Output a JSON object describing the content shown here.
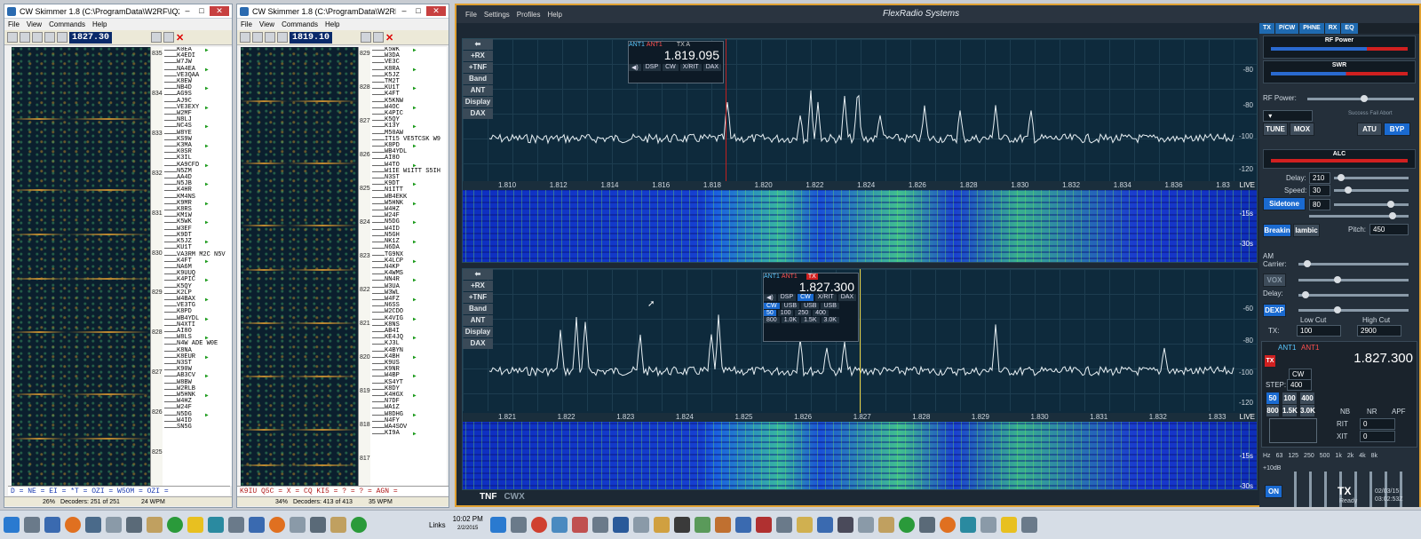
{
  "skimmer1": {
    "title": "CW Skimmer 1.8 (C:\\ProgramData\\W2RF\\IQ2.ini...",
    "freq": "1827.30",
    "menu": [
      "File",
      "View",
      "Commands",
      "Help"
    ],
    "scale": [
      "835",
      "834",
      "833",
      "832",
      "831",
      "830",
      "829",
      "828",
      "827",
      "826",
      "825"
    ],
    "calls": [
      "K0EA",
      "K4EDI",
      "W7JW",
      "NA4EA",
      "VE3QAA",
      "K8EW",
      "NB4D",
      "AG9S",
      "AJ9C",
      "VE3EXY",
      "W2MF",
      "N8LJ",
      "NC4S",
      "W8YE",
      "KS9W",
      "K3MA",
      "K0SR",
      "K3IL",
      "KA9CFD",
      "N5ZM",
      "AA4D",
      "N5JB",
      "K4HR",
      "KM4NS",
      "K9MR",
      "K8RS",
      "KM1W",
      "K5WK",
      "W3EF",
      "K9DT",
      "K5JZ",
      "KU1T",
      "VA3RM M2C N5V",
      "K4FT",
      "NA6M",
      "K9UUQ",
      "K4PIC",
      "K5QY",
      "K2LP",
      "W4BAX",
      "VE3TG",
      "K8PD",
      "WB4YDL",
      "N4XTI",
      "AI8O",
      "W8LS",
      "N4W ADE W0E",
      "K8NA",
      "K8EUR",
      "N3ST",
      "K90W",
      "AB3CV",
      "W8BW",
      "W2RLB",
      "W5HNK",
      "W4HZ",
      "W24F",
      "N5DG",
      "W4ID",
      "SN5G"
    ],
    "ticker": "D = NE = EI = *T = OZI = W5OM = OZI =",
    "status": {
      "pct": "26%",
      "decoders": "Decoders: 251 of 251",
      "wpm": "24 WPM"
    }
  },
  "skimmer2": {
    "title": "CW Skimmer 1.8 (C:\\ProgramData\\W2RF\\IQ...",
    "freq": "1819.10",
    "menu": [
      "File",
      "View",
      "Commands",
      "Help"
    ],
    "scale": [
      "829",
      "828",
      "827",
      "826",
      "825",
      "824",
      "823",
      "822",
      "821",
      "820",
      "819",
      "818",
      "817"
    ],
    "calls": [
      "K5WK",
      "W3DA",
      "VE3C",
      "K8RA",
      "K5JZ",
      "TM2T",
      "KU1T",
      "K4FT",
      "K5KNW",
      "W4OC",
      "K4PIC",
      "K5QY",
      "K13Y",
      "M50AW",
      "IT15 VE5TCSK W9",
      "K8PD",
      "WB4YDL",
      "AI8O",
      "W4TO",
      "W1IE W1ITT S5IH",
      "N3ST",
      "K9DT",
      "N1ITT",
      "WB4EKK",
      "W5HNK",
      "W4HZ",
      "W24F",
      "N5DG",
      "W4ID",
      "N5GH",
      "NK1Z",
      "N6DA",
      "TG9NX",
      "K4LCP",
      "N4KP",
      "K4WMS",
      "NN4R",
      "W3UA",
      "W3WL",
      "W4FZ",
      "N6SS",
      "W2CDO",
      "K4VIG",
      "K8NS",
      "AB4I",
      "KE4JQ",
      "KJ3L",
      "K4BYN",
      "K4BH",
      "K9US",
      "K9NR",
      "W4BP",
      "KS4YT",
      "K8DY",
      "K4HGX",
      "N7DF",
      "WA1Z",
      "W8DHG",
      "N4FY",
      "WA4SOV",
      "KI9A"
    ],
    "ticker": "K9IU Q5C = X = CQ KI5 = ? = ? = AGN =",
    "status": {
      "pct": "34%",
      "decoders": "Decoders: 413 of 413",
      "wpm": "35 WPM"
    }
  },
  "flex": {
    "menu": [
      "File",
      "Settings",
      "Profiles",
      "Help"
    ],
    "brand": "FlexRadio Systems",
    "sidebtns": [
      "+RX",
      "+TNF",
      "Band",
      "ANT",
      "Display",
      "DAX"
    ],
    "pan1": {
      "freq": "1.819.095",
      "ant1": "ANT1",
      "ant2": "ANT1",
      "axis": [
        "1.810",
        "1.812",
        "1.814",
        "1.816",
        "1.818",
        "1.820",
        "1.822",
        "1.824",
        "1.826",
        "1.828",
        "1.830",
        "1.832",
        "1.834",
        "1.836",
        "1.83"
      ],
      "db": [
        "-80",
        "-80",
        "-100",
        "-120"
      ],
      "wf": [
        "-15s",
        "-30s"
      ],
      "live": "LIVE",
      "tabs": [
        "DSP",
        "CW",
        "X/RIT",
        "DAX"
      ]
    },
    "pan2": {
      "freq": "1.827.300",
      "ant1": "ANT1",
      "ant2": "ANT1",
      "axis": [
        "1.821",
        "1.822",
        "1.823",
        "1.824",
        "1.825",
        "1.826",
        "1.827",
        "1.828",
        "1.829",
        "1.830",
        "1.831",
        "1.832",
        "1.833"
      ],
      "db": [
        "-60",
        "-80",
        "-100",
        "-120"
      ],
      "wf": [
        "-15s",
        "-30s"
      ],
      "live": "LIVE",
      "tabs": [
        "DSP",
        "CW",
        "X/RIT",
        "DAX"
      ],
      "modes": [
        "CW",
        "USB",
        "USB",
        "USB"
      ],
      "filters": [
        "50",
        "100",
        "250",
        "400",
        "800",
        "1.0K",
        "1.5K",
        "3.0K"
      ]
    },
    "bottom": {
      "tnf": "TNF",
      "cwx": "CWX"
    }
  },
  "panel": {
    "tabs": [
      "TX",
      "P/CW",
      "PHNE",
      "RX",
      "EQ"
    ],
    "rfpower_label": "RF Power",
    "swr_label": "SWR",
    "rfpower": "RF Power:",
    "tune": "TUNE",
    "mox": "MOX",
    "atu": "ATU",
    "byp": "BYP",
    "atu_status": "Success Fail Abort",
    "alc": "ALC",
    "delay_label": "Delay:",
    "delay": "210",
    "speed_label": "Speed:",
    "speed": "30",
    "sidetone": "Sidetone",
    "sidetone_val": "80",
    "breakin": "Breakin",
    "iambic": "Iambic",
    "pitch_label": "Pitch:",
    "pitch": "450",
    "am_carrier": "AM Carrier:",
    "vox": "VOX",
    "delay2": "Delay:",
    "dexp": "DEXP",
    "low_cut": "Low Cut",
    "high_cut": "High Cut",
    "tx": "TX:",
    "low_val": "100",
    "high_val": "2900",
    "slice_freq": "1.827.300",
    "slice_ant": "ANT1",
    "slice_mode": "CW",
    "step_label": "STEP:",
    "step": "400",
    "filters": [
      "50",
      "100",
      "400",
      "800",
      "1.5K",
      "3.0K"
    ],
    "nb": "NB",
    "nr": "NR",
    "apf": "APF",
    "rit": "RIT",
    "xit": "XIT",
    "rit_val": "0",
    "xit_val": "0",
    "eq": [
      "Hz",
      "63",
      "125",
      "250",
      "500",
      "1k",
      "2k",
      "4k",
      "8k"
    ],
    "eq_gain": "+10dB",
    "on": "ON",
    "tx_ready": "TX",
    "ready": "Ready",
    "date": "02/03/15",
    "time": "03:02:53Z"
  },
  "taskbar": {
    "time": "10:02 PM",
    "date": "2/2/2015",
    "links": "Links"
  }
}
